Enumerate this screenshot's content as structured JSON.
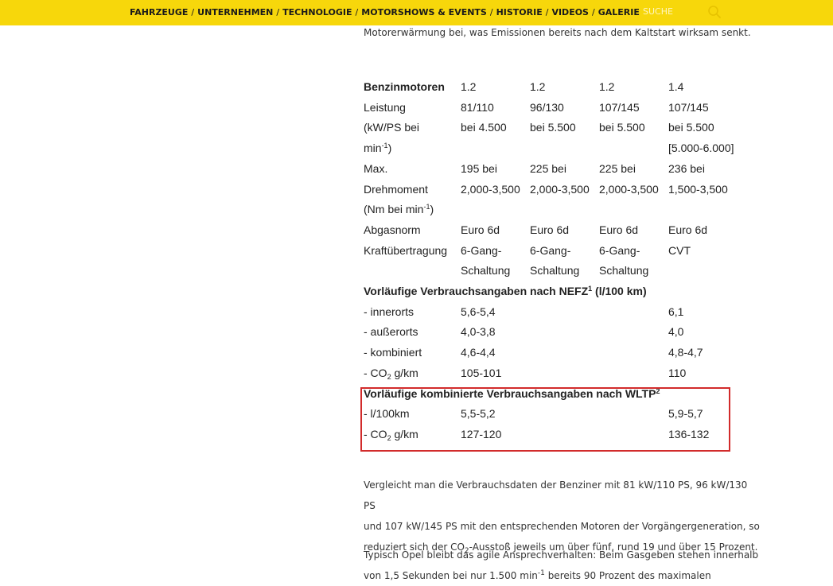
{
  "nav": {
    "items": [
      "FAHRZEUGE",
      "UNTERNEHMEN",
      "TECHNOLOGIE",
      "MOTORSHOWS & EVENTS",
      "HISTORIE",
      "VIDEOS",
      "GALERIE"
    ],
    "separator": "/",
    "search_label": "SUCHE"
  },
  "intro_line": "Motorerwärmung bei, was Emissionen bereits nach dem Kaltstart wirksam senkt.",
  "table": {
    "header": {
      "label": "Benzinmotoren",
      "values": [
        "1.2",
        "1.2",
        "1.2",
        "1.4"
      ]
    },
    "leistung": {
      "l1": "Leistung",
      "l2": "(kW/PS bei",
      "l3a": "min",
      "l3sup": "-1",
      "l3b": ")",
      "v1": [
        "81/110",
        "96/130",
        "107/145",
        "107/145"
      ],
      "v2": [
        "bei 4.500",
        "bei 5.500",
        "bei 5.500",
        "bei 5.500"
      ],
      "v3": "[5.000-6.000]"
    },
    "drehmoment": {
      "l1": "Max.",
      "l2": "Drehmoment",
      "l3a": "(Nm bei min",
      "l3sup": "-1",
      "l3b": ")",
      "v1": [
        "195 bei",
        "225 bei",
        "225 bei",
        "236 bei"
      ],
      "v2": [
        "2,000-3,500",
        "2,000-3,500",
        "2,000-3,500",
        "1,500-3,500"
      ]
    },
    "abgasnorm": {
      "label": "Abgasnorm",
      "values": [
        "Euro 6d",
        "Euro 6d",
        "Euro 6d",
        "Euro 6d"
      ]
    },
    "kraft": {
      "label": "Kraftübertragung",
      "v1": [
        "6-Gang-",
        "6-Gang-",
        "6-Gang-",
        "CVT"
      ],
      "v2": [
        "Schaltung",
        "Schaltung",
        "Schaltung",
        ""
      ]
    },
    "nefz": {
      "title_a": "Vorläufige Verbrauchsangaben nach NEFZ",
      "title_sup": "1",
      "title_b": " (l/100 km)",
      "innerorts": {
        "label": "- innerorts",
        "a": "5,6-5,4",
        "d": "6,1"
      },
      "ausserorts": {
        "label": "- außerorts",
        "a": "4,0-3,8",
        "d": "4,0"
      },
      "kombiniert": {
        "label": "- kombiniert",
        "a": "4,6-4,4",
        "d": "4,8-4,7"
      },
      "co2": {
        "label_a": "- CO",
        "label_sub": "2",
        "label_b": " g/km",
        "a": "105-101",
        "d": "110"
      }
    },
    "wltp": {
      "title_a": "Vorläufige kombinierte Verbrauchsangaben nach WLTP",
      "title_sup": "2",
      "l100": {
        "label": "- l/100km",
        "a": "5,5-5,2",
        "d": "5,9-5,7"
      },
      "co2": {
        "label_a": "- CO",
        "label_sub": "2",
        "label_b": " g/km",
        "a": "127-120",
        "d": "136-132"
      }
    }
  },
  "para1": {
    "l1": "Vergleicht man die Verbrauchsdaten der Benziner mit 81 kW/110 PS, 96 kW/130 PS",
    "l2": "und 107 kW/145 PS mit den entsprechenden Motoren der Vorgängergeneration, so",
    "l3a": "reduziert sich der CO",
    "l3sub": "2",
    "l3b": "-Ausstoß jeweils um über fünf, rund 19 und über 15 Prozent."
  },
  "para2": {
    "l1": "Typisch Opel bleibt das agile Ansprechverhalten: Beim Gasgeben stehen innerhalb",
    "l2a": "von 1,5 Sekunden bei nur 1.500 min",
    "l2sup": "-1",
    "l2b": " bereits 90 Prozent des maximalen"
  },
  "colors": {
    "topbar": "#f7d70b",
    "highlight_border": "#d22b2b"
  }
}
